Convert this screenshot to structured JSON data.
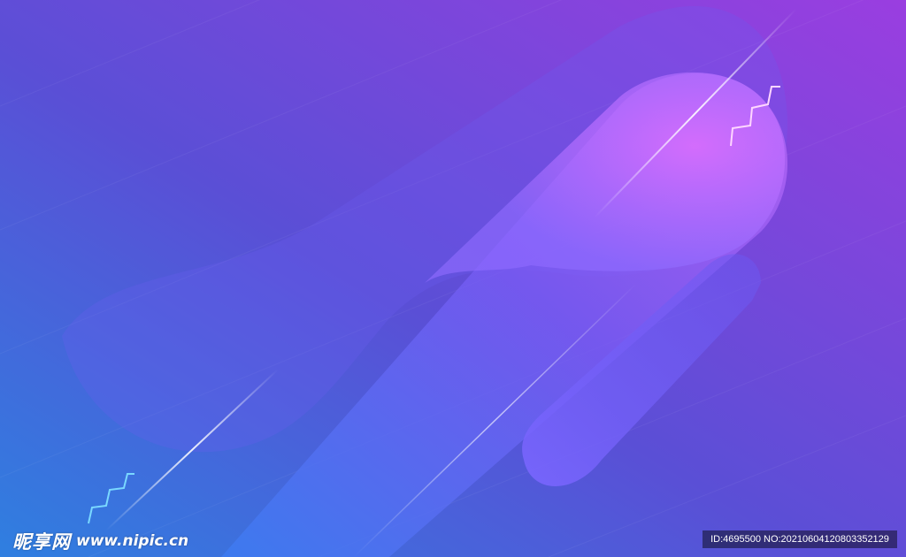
{
  "colors": {
    "background_start": "#2f7fe0",
    "background_mid": "#5a4fd6",
    "background_end": "#9a3ee0",
    "highlight_pink": "#e070ff",
    "highlight_violet": "#8f6bff",
    "streak": "#ffffff"
  },
  "watermark": {
    "logo_text": "昵享网",
    "url": "www.nipic.cn",
    "id_text": "ID:4695500 NO:20210604120803352129"
  }
}
